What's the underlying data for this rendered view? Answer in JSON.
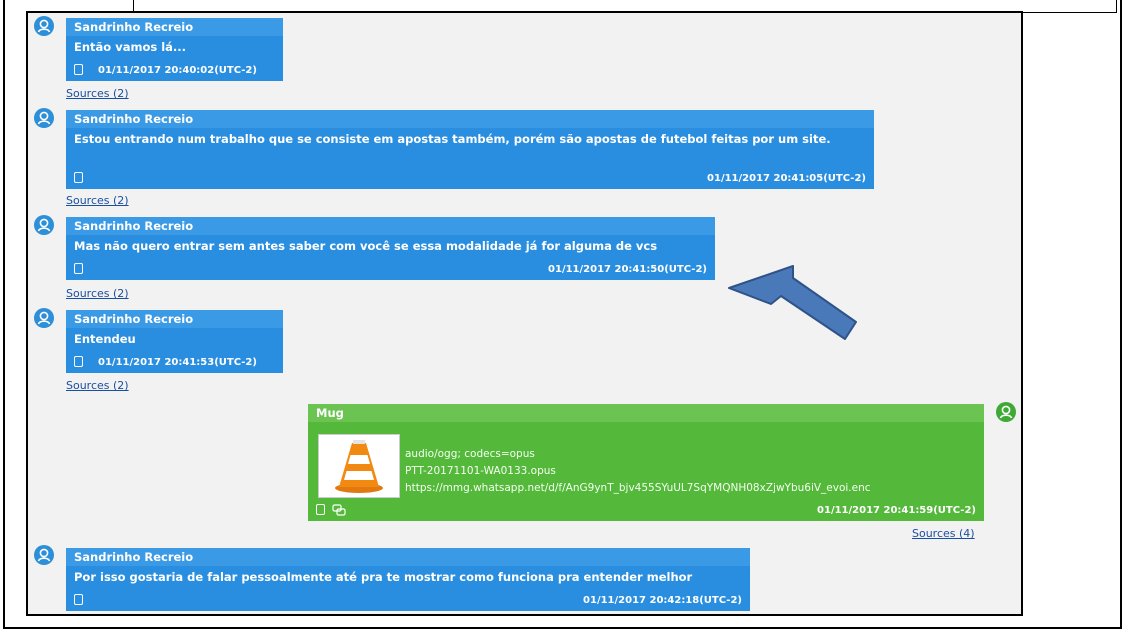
{
  "messages": [
    {
      "sender": "Sandrinho Recreio",
      "text": "Então vamos lá...",
      "timestamp": "01/11/2017 20:40:02(UTC-2)",
      "sources": "Sources (2)"
    },
    {
      "sender": "Sandrinho Recreio",
      "text": "Estou entrando num trabalho que se consiste em apostas também,  porém são apostas de futebol feitas por um site.",
      "timestamp": "01/11/2017 20:41:05(UTC-2)",
      "sources": "Sources (2)"
    },
    {
      "sender": "Sandrinho Recreio",
      "text": "Mas não quero entrar sem antes saber com você se essa modalidade já for alguma de vcs",
      "timestamp": "01/11/2017 20:41:50(UTC-2)",
      "sources": "Sources (2)"
    },
    {
      "sender": "Sandrinho Recreio",
      "text": "Entendeu",
      "timestamp": "01/11/2017 20:41:53(UTC-2)",
      "sources": "Sources (2)"
    },
    {
      "sender": "Mug",
      "attachment": {
        "mime": "audio/ogg; codecs=opus",
        "filename": "PTT-20171101-WA0133.opus",
        "url": "https://mmg.whatsapp.net/d/f/AnG9ynT_bjv455SYuUL7SqYMQNH08xZjwYbu6iV_evoi.enc",
        "icon": "vlc-cone-icon"
      },
      "timestamp": "01/11/2017 20:41:59(UTC-2)",
      "sources": "Sources (4)"
    },
    {
      "sender": "Sandrinho Recreio",
      "text": "Por isso gostaria de falar pessoalmente até pra te mostrar como funciona pra entender melhor",
      "timestamp": "01/11/2017 20:42:18(UTC-2)"
    }
  ],
  "colors": {
    "incoming": "#2a8ee0",
    "outgoing": "#54b83b",
    "arrow": "#4a79b9"
  },
  "icons": {
    "avatar": "user-avatar-icon",
    "device": "mobile-device-icon",
    "chat": "chat-bubbles-icon",
    "annotation": "annotation-arrow"
  }
}
